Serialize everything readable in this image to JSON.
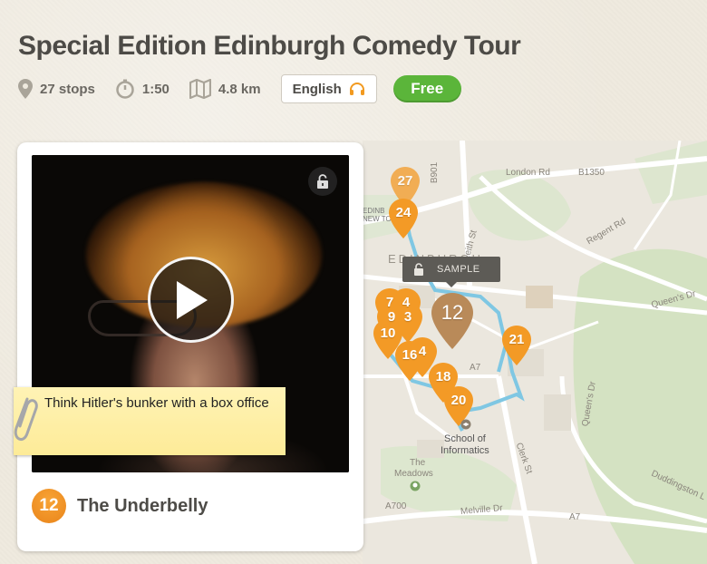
{
  "tour": {
    "title": "Special Edition Edinburgh Comedy Tour",
    "stops": "27 stops",
    "duration": "1:50",
    "distance": "4.8 km",
    "language": "English",
    "price": "Free"
  },
  "map": {
    "sample_label": "SAMPLE",
    "labels": {
      "london_rd": "London Rd",
      "b1350": "B1350",
      "regent_rd": "Regent Rd",
      "queens_dr": "Queen's Dr",
      "queens_dr_vert": "Queen's Dr",
      "leith_st": "Leith St",
      "edinburgh": "EDINBURGH",
      "school": "School of",
      "informatics": "Informatics",
      "the": "The",
      "meadows": "Meadows",
      "a700": "A700",
      "melville_dr": "Melville Dr",
      "a7_a": "A7",
      "a7_b": "A7",
      "clerk_st": "Clerk St",
      "duddingston": "Duddingston L",
      "edin_left": "EDINB",
      "new_left": "NEW TO",
      "b901": "B901"
    },
    "pins": [
      "27",
      "24",
      "12",
      "7",
      "4",
      "9",
      "3",
      "10",
      "16",
      "4",
      "21",
      "18",
      "20"
    ]
  },
  "card": {
    "note_text": "Think Hitler's bunker with a box office",
    "stop_number": "12",
    "stop_name": "The Underbelly"
  },
  "colors": {
    "pin_orange": "#f39a26",
    "pin_active": "#b98a59",
    "free_green": "#5bb53a",
    "route_blue": "#7fc7e3"
  }
}
